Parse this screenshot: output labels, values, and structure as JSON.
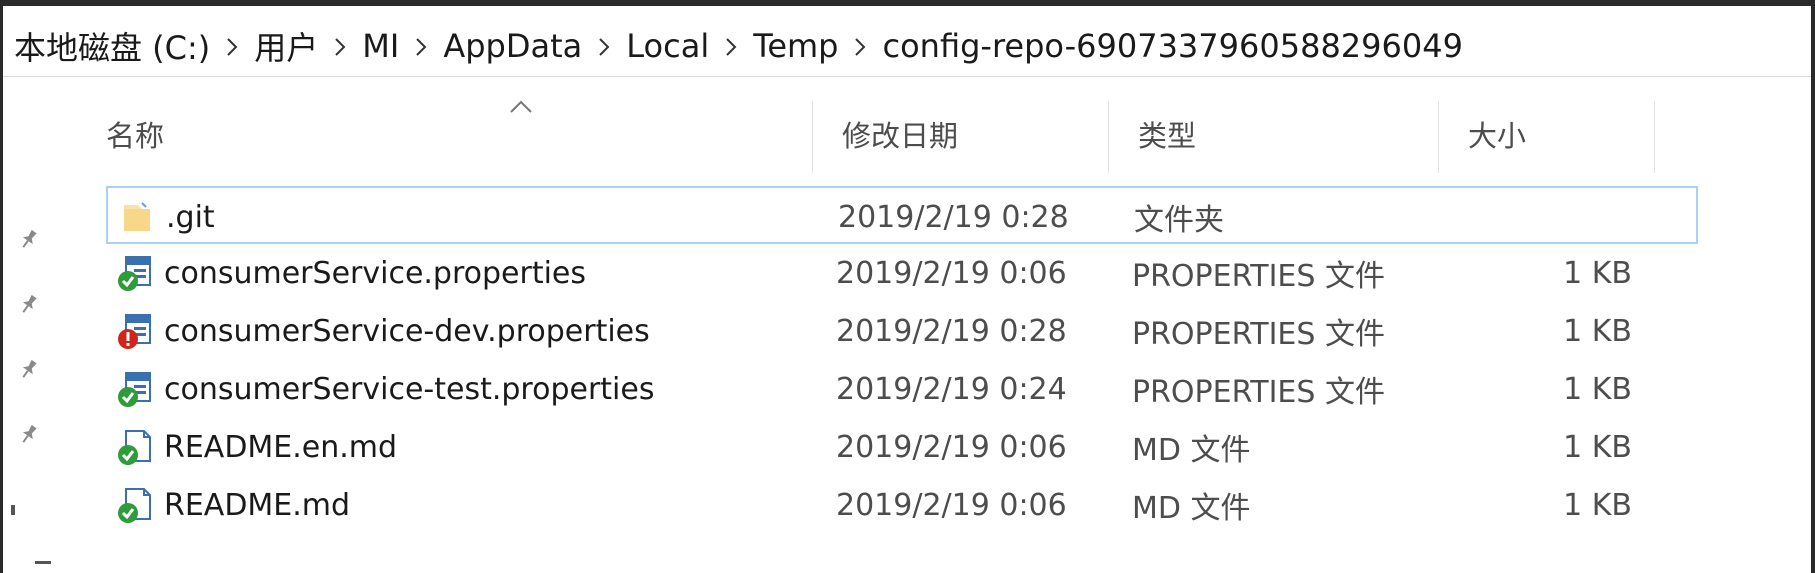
{
  "breadcrumb": {
    "items": [
      "本地磁盘 (C:)",
      "用户",
      "MI",
      "AppData",
      "Local",
      "Temp",
      "config-repo-6907337960588296049"
    ]
  },
  "columns": {
    "name": "名称",
    "modified": "修改日期",
    "type": "类型",
    "size": "大小"
  },
  "files": [
    {
      "name": ".git",
      "modified": "2019/2/19 0:28",
      "type": "文件夹",
      "size": "",
      "icon": "folder-icon",
      "selected": true
    },
    {
      "name": "consumerService.properties",
      "modified": "2019/2/19 0:06",
      "type": "PROPERTIES 文件",
      "size": "1 KB",
      "icon": "properties-file-ok-icon"
    },
    {
      "name": "consumerService-dev.properties",
      "modified": "2019/2/19 0:28",
      "type": "PROPERTIES 文件",
      "size": "1 KB",
      "icon": "properties-file-modified-icon"
    },
    {
      "name": "consumerService-test.properties",
      "modified": "2019/2/19 0:24",
      "type": "PROPERTIES 文件",
      "size": "1 KB",
      "icon": "properties-file-ok-icon"
    },
    {
      "name": "README.en.md",
      "modified": "2019/2/19 0:06",
      "type": "MD 文件",
      "size": "1 KB",
      "icon": "md-file-ok-icon"
    },
    {
      "name": "README.md",
      "modified": "2019/2/19 0:06",
      "type": "MD 文件",
      "size": "1 KB",
      "icon": "md-file-ok-icon"
    }
  ],
  "colors": {
    "selection_border": "#a9d2f2",
    "git_ok_badge": "#2e9c3a",
    "git_modified_badge": "#d0241c",
    "folder": "#f5d37a"
  }
}
